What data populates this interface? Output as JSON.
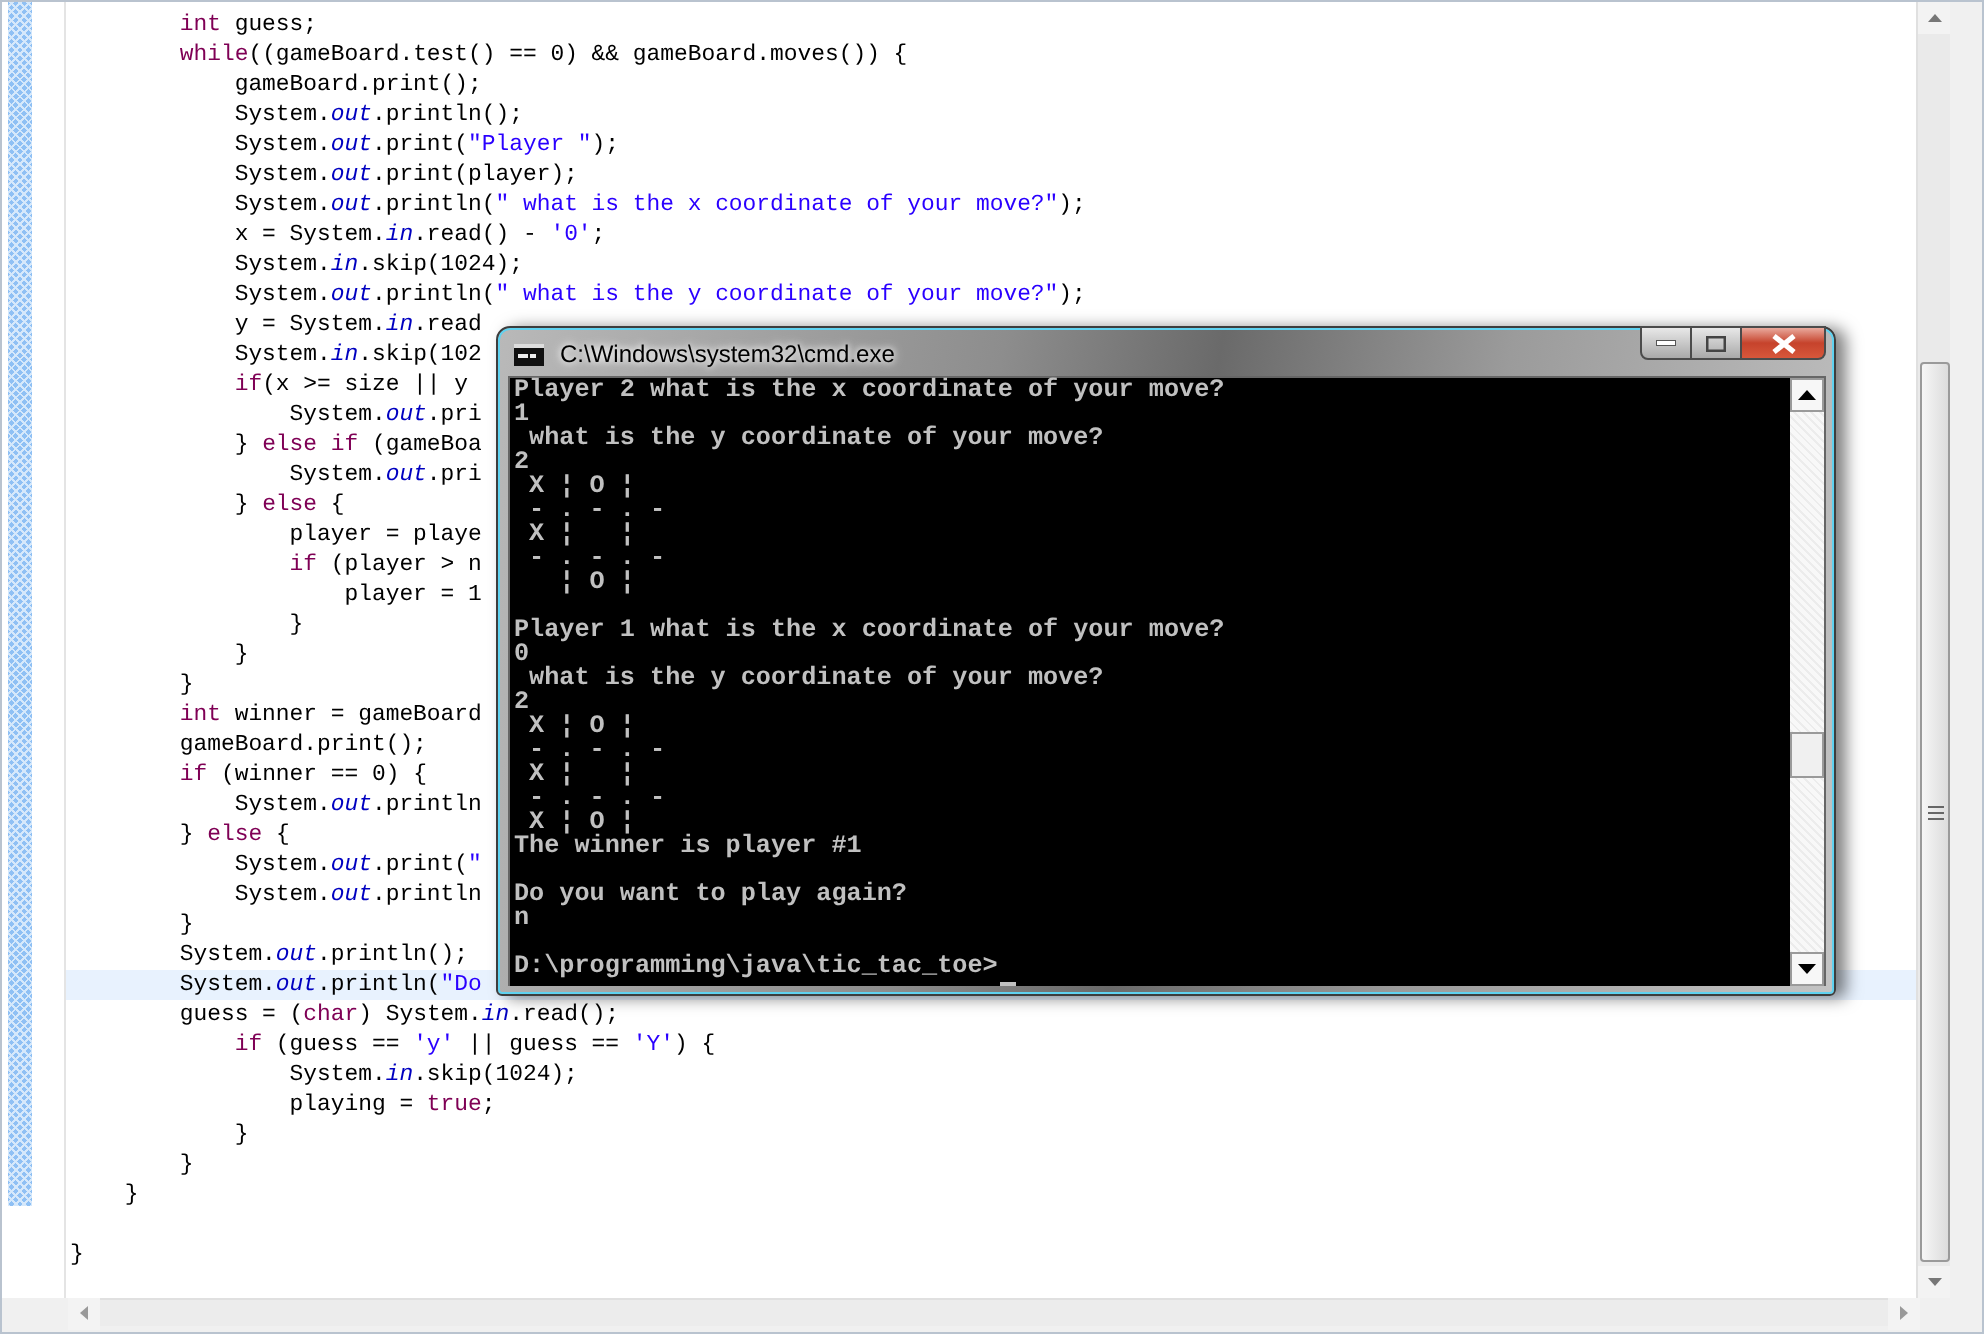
{
  "editor": {
    "lines": [
      {
        "current": false,
        "tokens": [
          {
            "kind": "keyword",
            "text": "        int"
          },
          {
            "kind": "plain",
            "text": " guess;"
          }
        ]
      },
      {
        "current": false,
        "tokens": [
          {
            "kind": "keyword",
            "text": "        while"
          },
          {
            "kind": "plain",
            "text": "((gameBoard.test() == 0) && gameBoard.moves()) {"
          }
        ]
      },
      {
        "current": false,
        "tokens": [
          {
            "kind": "plain",
            "text": "            gameBoard.print();"
          }
        ]
      },
      {
        "current": false,
        "tokens": [
          {
            "kind": "plain",
            "text": "            System."
          },
          {
            "kind": "field",
            "text": "out"
          },
          {
            "kind": "plain",
            "text": ".println();"
          }
        ]
      },
      {
        "current": false,
        "tokens": [
          {
            "kind": "plain",
            "text": "            System."
          },
          {
            "kind": "field",
            "text": "out"
          },
          {
            "kind": "plain",
            "text": ".print("
          },
          {
            "kind": "string",
            "text": "\"Player \""
          },
          {
            "kind": "plain",
            "text": ");"
          }
        ]
      },
      {
        "current": false,
        "tokens": [
          {
            "kind": "plain",
            "text": "            System."
          },
          {
            "kind": "field",
            "text": "out"
          },
          {
            "kind": "plain",
            "text": ".print(player);"
          }
        ]
      },
      {
        "current": false,
        "tokens": [
          {
            "kind": "plain",
            "text": "            System."
          },
          {
            "kind": "field",
            "text": "out"
          },
          {
            "kind": "plain",
            "text": ".println("
          },
          {
            "kind": "string",
            "text": "\" what is the x coordinate of your move?\""
          },
          {
            "kind": "plain",
            "text": ");"
          }
        ]
      },
      {
        "current": false,
        "tokens": [
          {
            "kind": "plain",
            "text": "            x = System."
          },
          {
            "kind": "field",
            "text": "in"
          },
          {
            "kind": "plain",
            "text": ".read() - "
          },
          {
            "kind": "string",
            "text": "'0'"
          },
          {
            "kind": "plain",
            "text": ";"
          }
        ]
      },
      {
        "current": false,
        "tokens": [
          {
            "kind": "plain",
            "text": "            System."
          },
          {
            "kind": "field",
            "text": "in"
          },
          {
            "kind": "plain",
            "text": ".skip(1024);"
          }
        ]
      },
      {
        "current": false,
        "tokens": [
          {
            "kind": "plain",
            "text": "            System."
          },
          {
            "kind": "field",
            "text": "out"
          },
          {
            "kind": "plain",
            "text": ".println("
          },
          {
            "kind": "string",
            "text": "\" what is the y coordinate of your move?\""
          },
          {
            "kind": "plain",
            "text": ");"
          }
        ]
      },
      {
        "current": false,
        "tokens": [
          {
            "kind": "plain",
            "text": "            y = System."
          },
          {
            "kind": "field",
            "text": "in"
          },
          {
            "kind": "plain",
            "text": ".read"
          }
        ]
      },
      {
        "current": false,
        "tokens": [
          {
            "kind": "plain",
            "text": "            System."
          },
          {
            "kind": "field",
            "text": "in"
          },
          {
            "kind": "plain",
            "text": ".skip(102"
          }
        ]
      },
      {
        "current": false,
        "tokens": [
          {
            "kind": "keyword",
            "text": "            if"
          },
          {
            "kind": "plain",
            "text": "(x >= size || y"
          }
        ]
      },
      {
        "current": false,
        "tokens": [
          {
            "kind": "plain",
            "text": "                System."
          },
          {
            "kind": "field",
            "text": "out"
          },
          {
            "kind": "plain",
            "text": ".pri"
          }
        ]
      },
      {
        "current": false,
        "tokens": [
          {
            "kind": "plain",
            "text": "            } "
          },
          {
            "kind": "keyword",
            "text": "else if"
          },
          {
            "kind": "plain",
            "text": " (gameBoa"
          }
        ]
      },
      {
        "current": false,
        "tokens": [
          {
            "kind": "plain",
            "text": "                System."
          },
          {
            "kind": "field",
            "text": "out"
          },
          {
            "kind": "plain",
            "text": ".pri"
          }
        ]
      },
      {
        "current": false,
        "tokens": [
          {
            "kind": "plain",
            "text": "            } "
          },
          {
            "kind": "keyword",
            "text": "else"
          },
          {
            "kind": "plain",
            "text": " {"
          }
        ]
      },
      {
        "current": false,
        "tokens": [
          {
            "kind": "plain",
            "text": "                player = playe"
          }
        ]
      },
      {
        "current": false,
        "tokens": [
          {
            "kind": "keyword",
            "text": "                if"
          },
          {
            "kind": "plain",
            "text": " (player > n"
          }
        ]
      },
      {
        "current": false,
        "tokens": [
          {
            "kind": "plain",
            "text": "                    player = 1"
          }
        ]
      },
      {
        "current": false,
        "tokens": [
          {
            "kind": "plain",
            "text": "                }"
          }
        ]
      },
      {
        "current": false,
        "tokens": [
          {
            "kind": "plain",
            "text": "            }"
          }
        ]
      },
      {
        "current": false,
        "tokens": [
          {
            "kind": "plain",
            "text": "        }"
          }
        ]
      },
      {
        "current": false,
        "tokens": [
          {
            "kind": "keyword",
            "text": "        int"
          },
          {
            "kind": "plain",
            "text": " winner = gameBoard"
          }
        ]
      },
      {
        "current": false,
        "tokens": [
          {
            "kind": "plain",
            "text": "        gameBoard.print();"
          }
        ]
      },
      {
        "current": false,
        "tokens": [
          {
            "kind": "keyword",
            "text": "        if"
          },
          {
            "kind": "plain",
            "text": " (winner == 0) {"
          }
        ]
      },
      {
        "current": false,
        "tokens": [
          {
            "kind": "plain",
            "text": "            System."
          },
          {
            "kind": "field",
            "text": "out"
          },
          {
            "kind": "plain",
            "text": ".println"
          }
        ]
      },
      {
        "current": false,
        "tokens": [
          {
            "kind": "plain",
            "text": "        } "
          },
          {
            "kind": "keyword",
            "text": "else"
          },
          {
            "kind": "plain",
            "text": " {"
          }
        ]
      },
      {
        "current": false,
        "tokens": [
          {
            "kind": "plain",
            "text": "            System."
          },
          {
            "kind": "field",
            "text": "out"
          },
          {
            "kind": "plain",
            "text": ".print("
          },
          {
            "kind": "string",
            "text": "\""
          }
        ]
      },
      {
        "current": false,
        "tokens": [
          {
            "kind": "plain",
            "text": "            System."
          },
          {
            "kind": "field",
            "text": "out"
          },
          {
            "kind": "plain",
            "text": ".println"
          }
        ]
      },
      {
        "current": false,
        "tokens": [
          {
            "kind": "plain",
            "text": "        }"
          }
        ]
      },
      {
        "current": false,
        "tokens": [
          {
            "kind": "plain",
            "text": "        System."
          },
          {
            "kind": "field",
            "text": "out"
          },
          {
            "kind": "plain",
            "text": ".println();"
          }
        ]
      },
      {
        "current": true,
        "tokens": [
          {
            "kind": "plain",
            "text": "        System."
          },
          {
            "kind": "field",
            "text": "out"
          },
          {
            "kind": "plain",
            "text": ".println("
          },
          {
            "kind": "string",
            "text": "\"Do"
          }
        ]
      },
      {
        "current": false,
        "tokens": [
          {
            "kind": "plain",
            "text": "        guess = ("
          },
          {
            "kind": "keyword",
            "text": "char"
          },
          {
            "kind": "plain",
            "text": ") System."
          },
          {
            "kind": "field",
            "text": "in"
          },
          {
            "kind": "plain",
            "text": ".read();"
          }
        ]
      },
      {
        "current": false,
        "tokens": [
          {
            "kind": "keyword",
            "text": "            if"
          },
          {
            "kind": "plain",
            "text": " (guess == "
          },
          {
            "kind": "string",
            "text": "'y'"
          },
          {
            "kind": "plain",
            "text": " || guess == "
          },
          {
            "kind": "string",
            "text": "'Y'"
          },
          {
            "kind": "plain",
            "text": ") {"
          }
        ]
      },
      {
        "current": false,
        "tokens": [
          {
            "kind": "plain",
            "text": "                System."
          },
          {
            "kind": "field",
            "text": "in"
          },
          {
            "kind": "plain",
            "text": ".skip(1024);"
          }
        ]
      },
      {
        "current": false,
        "tokens": [
          {
            "kind": "plain",
            "text": "                playing = "
          },
          {
            "kind": "keyword",
            "text": "true"
          },
          {
            "kind": "plain",
            "text": ";"
          }
        ]
      },
      {
        "current": false,
        "tokens": [
          {
            "kind": "plain",
            "text": "            }"
          }
        ]
      },
      {
        "current": false,
        "tokens": [
          {
            "kind": "plain",
            "text": "        }"
          }
        ]
      },
      {
        "current": false,
        "tokens": [
          {
            "kind": "plain",
            "text": "    }"
          }
        ]
      },
      {
        "current": false,
        "gap_before": true,
        "tokens": [
          {
            "kind": "plain",
            "text": "}"
          }
        ]
      }
    ]
  },
  "console_window": {
    "title": "C:\\Windows\\system32\\cmd.exe",
    "lines": [
      {
        "text": "Player 2 what is the x coordinate of your move?"
      },
      {
        "text": "1"
      },
      {
        "text": " what is the y coordinate of your move?"
      },
      {
        "text": "2"
      },
      {
        "text": " X ¦ O ¦"
      },
      {
        "text": " - . - . -"
      },
      {
        "text": " X ¦   ¦"
      },
      {
        "text": " - . - . -"
      },
      {
        "text": "   ¦ O ¦"
      },
      {
        "text": "Player 1 what is the x coordinate of your move?",
        "gap_before": true
      },
      {
        "text": "0"
      },
      {
        "text": " what is the y coordinate of your move?"
      },
      {
        "text": "2"
      },
      {
        "text": " X ¦ O ¦"
      },
      {
        "text": " - . - . -"
      },
      {
        "text": " X ¦   ¦"
      },
      {
        "text": " - . - . -"
      },
      {
        "text": " X ¦ O ¦"
      },
      {
        "text": "The winner is player #1"
      },
      {
        "text": "Do you want to play again?",
        "gap_before": true
      },
      {
        "text": "n"
      },
      {
        "text": "D:\\programming\\java\\tic_tac_toe>",
        "gap_before": true,
        "cursor": true
      }
    ]
  }
}
